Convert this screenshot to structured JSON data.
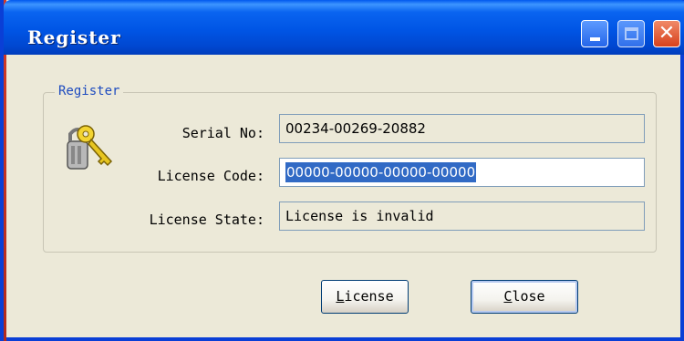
{
  "window": {
    "title": "Register"
  },
  "titlebar_buttons": {
    "minimize_icon": "minimize-icon",
    "maximize_icon": "maximize-icon",
    "close_icon": "close-icon",
    "close_glyph": "✕"
  },
  "group": {
    "legend": "Register",
    "icon": "key-icon"
  },
  "fields": {
    "serial_label": "Serial No:",
    "serial_value": "00234-00269-20882",
    "license_label": "License Code:",
    "license_value": "00000-00000-00000-00000",
    "state_label": "License State:",
    "state_value": "License is invalid"
  },
  "buttons": {
    "license_mnemonic": "L",
    "license_rest": "icense",
    "close_mnemonic": "C",
    "close_rest": "lose"
  },
  "colors": {
    "titlebar": "#0055e5",
    "face": "#ece9d8",
    "selection": "#316ac5",
    "legend_text": "#1d4bbf"
  }
}
